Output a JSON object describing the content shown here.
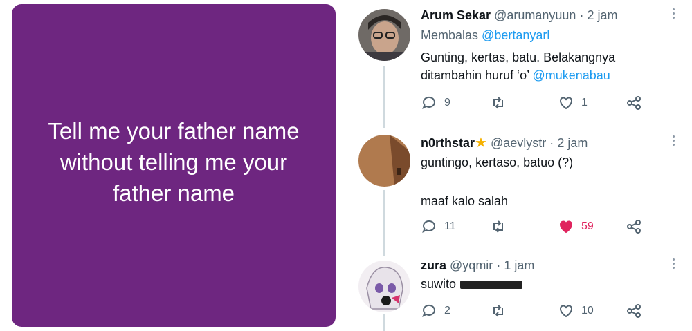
{
  "image_card": {
    "text": "Tell me your father name without telling me your father name"
  },
  "tweets": [
    {
      "name": "Arum Sekar",
      "handle": "@arumanyuun",
      "dot": "·",
      "time": "2 jam",
      "replying_label": "Membalas",
      "replying_to": "@bertanyarl",
      "body_line1": "Gunting, kertas, batu. Belakangnya",
      "body_line2": "ditambahin huruf ‘o’",
      "body_mention": "@mukenabau",
      "replies": "9",
      "retweets": "",
      "likes": "1"
    },
    {
      "name": "n0rthstar",
      "badge": "★",
      "handle": "@aevlystr",
      "dot": "·",
      "time": "2 jam",
      "body_line1": "guntingo, kertaso, batuo (?)",
      "body_line2": "maaf kalo salah",
      "replies": "11",
      "retweets": "",
      "likes": "59"
    },
    {
      "name": "zura",
      "handle": "@yqmir",
      "dot": "·",
      "time": "1 jam",
      "body_line1": "suwito",
      "replies": "2",
      "retweets": "",
      "likes": "10"
    }
  ],
  "colors": {
    "card": "#6e2680",
    "link": "#1d9bf0",
    "like_active": "#e0245e",
    "muted": "#536471"
  }
}
